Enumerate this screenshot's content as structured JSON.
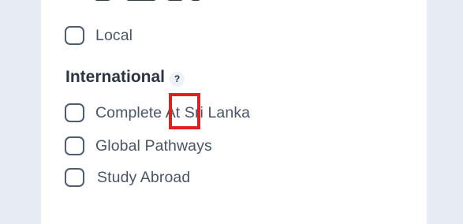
{
  "filters": {
    "local_option": {
      "label": "Local",
      "checked": false
    },
    "international": {
      "title": "International",
      "help_symbol": "?",
      "options": [
        {
          "label": "Complete At Sri Lanka",
          "checked": false
        },
        {
          "label": "Global Pathways",
          "checked": false
        },
        {
          "label": "Study Abroad",
          "checked": false
        }
      ]
    }
  },
  "annotation": {
    "highlight_color": "#e02020"
  }
}
